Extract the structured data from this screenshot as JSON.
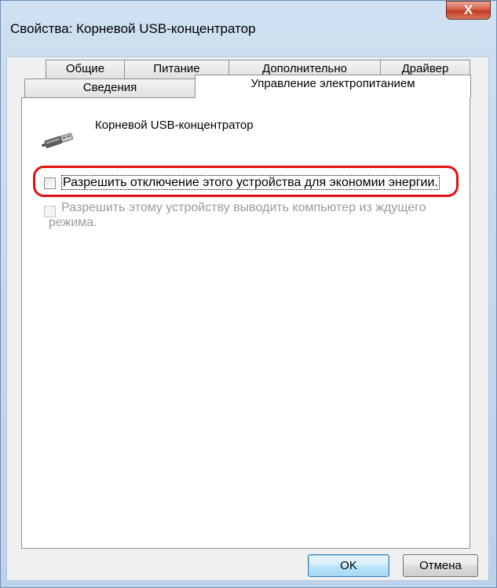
{
  "window": {
    "title": "Свойства: Корневой USB-концентратор",
    "close_label": "X"
  },
  "tabs": {
    "row1": [
      {
        "label": "Общие"
      },
      {
        "label": "Питание"
      },
      {
        "label": "Дополнительно"
      },
      {
        "label": "Драйвер"
      }
    ],
    "row2": [
      {
        "label": "Сведения"
      },
      {
        "label": "Управление электропитанием"
      }
    ],
    "active": "Управление электропитанием"
  },
  "device": {
    "name": "Корневой USB-концентратор",
    "icon": "usb-plug-icon"
  },
  "options": [
    {
      "label": "Разрешить отключение этого устройства для экономии энергии.",
      "checked": false,
      "enabled": true,
      "highlighted": true
    },
    {
      "label_line1": "Разрешить этому устройству выводить компьютер из ждущего",
      "label_line2": "режима.",
      "checked": false,
      "enabled": false
    }
  ],
  "buttons": {
    "ok": "OK",
    "cancel": "Отмена"
  },
  "colors": {
    "highlight": "#e01212",
    "close_button": "#c94a33",
    "frame": "#c3d6ec"
  }
}
